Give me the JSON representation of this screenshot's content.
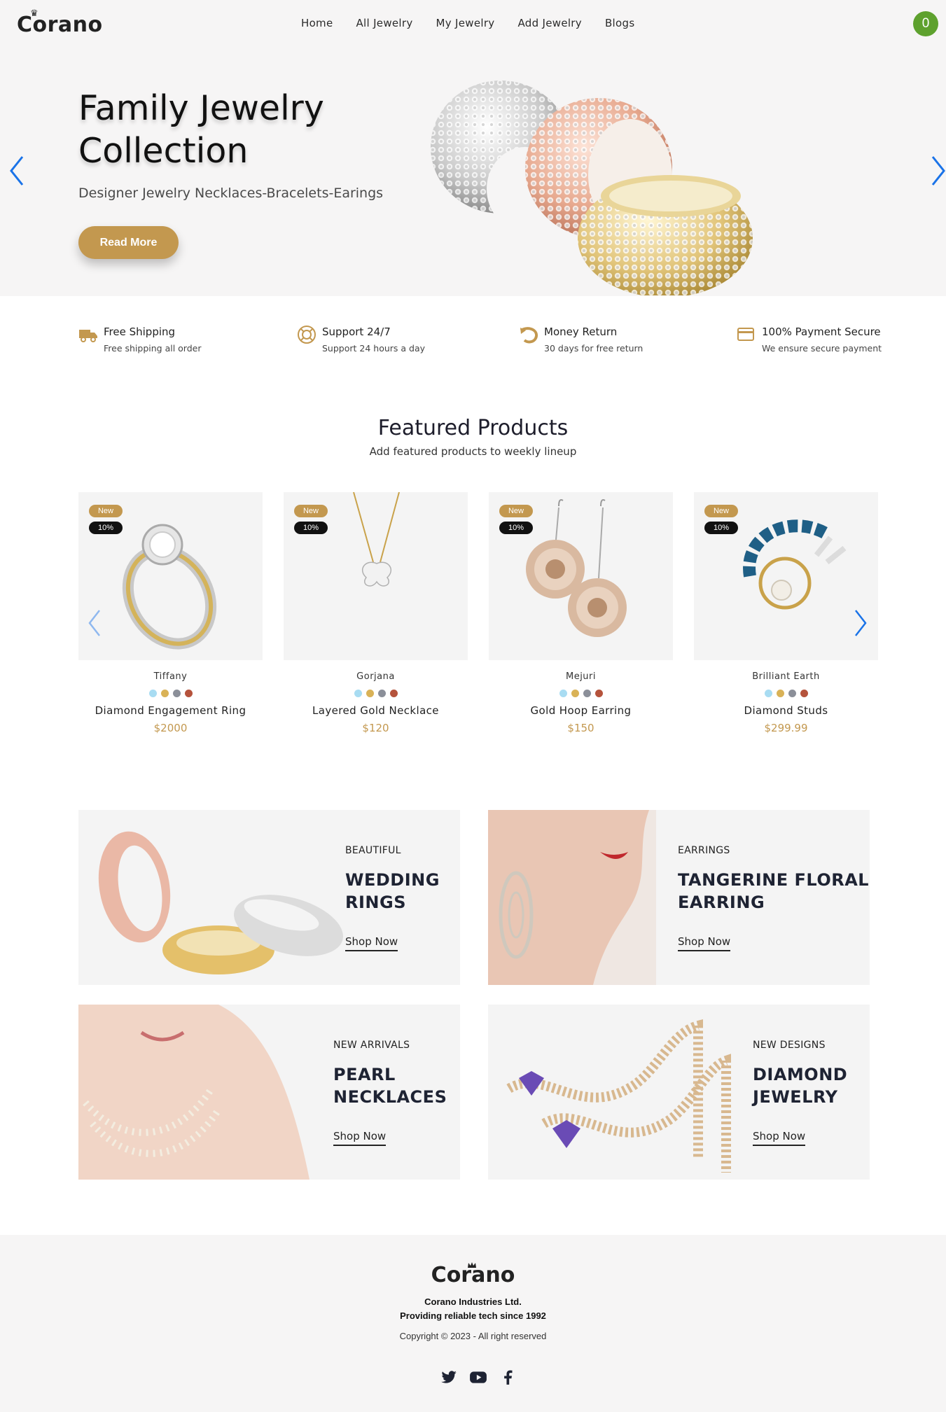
{
  "header": {
    "logo": "Corano",
    "nav": [
      "Home",
      "All Jewelry",
      "My Jewelry",
      "Add Jewelry",
      "Blogs"
    ],
    "cart_count": "0"
  },
  "hero": {
    "title": "Family Jewelry Collection",
    "subtitle": "Designer Jewelry Necklaces-Bracelets-Earings",
    "button": "Read More"
  },
  "features": [
    {
      "title": "Free Shipping",
      "subtitle": "Free shipping all order",
      "icon": "truck-icon"
    },
    {
      "title": "Support 24/7",
      "subtitle": "Support 24 hours a day",
      "icon": "support-icon"
    },
    {
      "title": "Money Return",
      "subtitle": "30 days for free return",
      "icon": "return-icon"
    },
    {
      "title": "100% Payment Secure",
      "subtitle": "We ensure secure payment",
      "icon": "card-icon"
    }
  ],
  "featured": {
    "title": "Featured Products",
    "subtitle": "Add featured products to weekly lineup",
    "badge_new": "New",
    "badge_discount": "10%",
    "swatch_colors": [
      "#a8dcf2",
      "#d9b257",
      "#8b8f99",
      "#b5533c"
    ],
    "products": [
      {
        "brand": "Tiffany",
        "name": "Diamond Engagement Ring",
        "price": "$2000"
      },
      {
        "brand": "Gorjana",
        "name": "Layered Gold Necklace",
        "price": "$120"
      },
      {
        "brand": "Mejuri",
        "name": "Gold Hoop Earring",
        "price": "$150"
      },
      {
        "brand": "Brilliant Earth",
        "name": "Diamond Studs",
        "price": "$299.99"
      }
    ]
  },
  "banners": [
    {
      "small": "BEAUTIFUL",
      "title1": "WEDDING",
      "title2": "RINGS",
      "link": "Shop Now"
    },
    {
      "small": "EARRINGS",
      "title1": "TANGERINE FLORAL",
      "title2": "EARRING",
      "link": "Shop Now"
    },
    {
      "small": "NEW ARRIVALS",
      "title1": "PEARL",
      "title2": "NECKLACES",
      "link": "Shop Now"
    },
    {
      "small": "NEW DESIGNS",
      "title1": "DIAMOND",
      "title2": "JEWELRY",
      "link": "Shop Now"
    }
  ],
  "footer": {
    "logo": "Corano",
    "company": "Corano Industries Ltd.",
    "tagline": "Providing reliable tech since 1992",
    "copyright": "Copyright © 2023 - All right reserved"
  },
  "colors": {
    "accent": "#c3984f",
    "cart": "#5ea12e",
    "arrow": "#1a73e8"
  }
}
